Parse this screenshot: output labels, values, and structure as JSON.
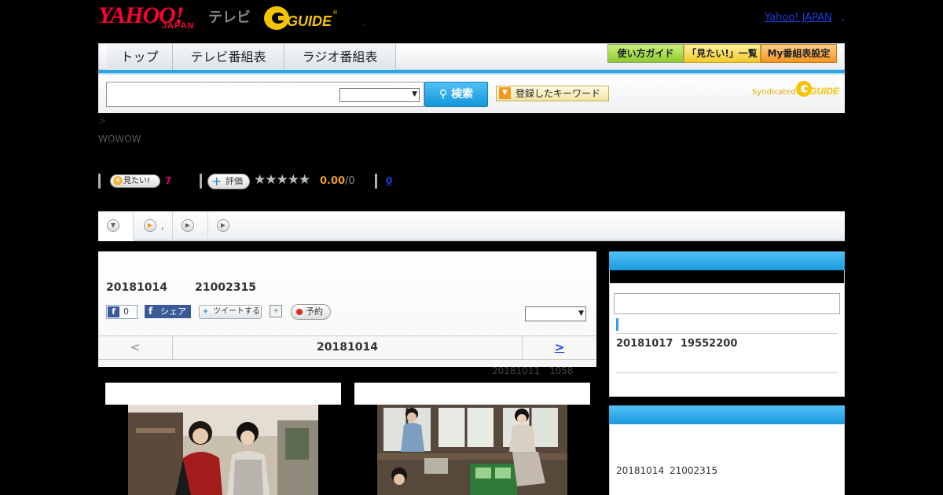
{
  "header": {
    "yahoo_logo": "YAHOO!",
    "japan_logo": "JAPAN",
    "tv_label": "テレビ",
    "gguide_logo": "G GUIDE",
    "separator_dot": ",",
    "yahoo_japan_link": "Yahoo! JAPAN",
    "trailing_dot": ","
  },
  "nav": {
    "tabs": [
      {
        "label": "トップ"
      },
      {
        "label": "テレビ番組表"
      },
      {
        "label": "ラジオ番組表"
      }
    ],
    "right_buttons": [
      {
        "label": "使い方ガイド"
      },
      {
        "label": "「見たい!」一覧"
      },
      {
        "label": "My番組表設定"
      }
    ]
  },
  "search": {
    "input_value": "",
    "select_value": "",
    "button_label": "検索",
    "keyword_button_label": "登録したキーワード",
    "syndicated_label": "Syndicated",
    "syndicated_logo": "G GUIDE"
  },
  "program": {
    "breadcrumb": ">",
    "channel": "WOWOW",
    "want_label": "見たい!",
    "want_count": "7",
    "rate_label": "評価",
    "stars": "★★★★★",
    "score": "0.00",
    "score_of": "/0",
    "review_count": "0"
  },
  "subtabs": {
    "tab2_text": ","
  },
  "main": {
    "date": "20181014",
    "time": "21002315",
    "fb_like_count": "0",
    "fb_share_label": "シェア",
    "tweet_label": "ツイートする",
    "record_label": "予約",
    "panel_select_value": "",
    "datenav_prev": "<",
    "datenav_title": "20181014",
    "datenav_next": ">",
    "updated_date": "20181011",
    "updated_time": "1058"
  },
  "sidebar": {
    "input_value": "",
    "schedule_date": "20181017",
    "schedule_time": "19552200",
    "footer_date": "20181014",
    "footer_time": "21002315"
  },
  "colors": {
    "accent_blue": "#29a6e8",
    "yahoo_red": "#ff0033",
    "link_blue": "#1a3edb",
    "want_pink": "#e4007f",
    "score_orange": "#e89a2c"
  }
}
